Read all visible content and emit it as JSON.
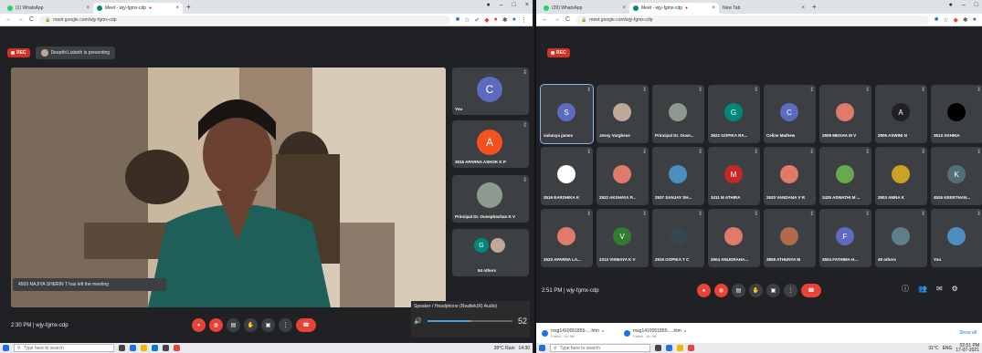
{
  "left": {
    "tabs": [
      {
        "label": "(1) WhatsApp"
      },
      {
        "label": "Meet - wjy-fgmx-cdp"
      }
    ],
    "url": "meet.google.com/wjy-fgmx-cdp",
    "rec": "REC",
    "presenting": "Deepthi Lisbeth is presenting",
    "side_tiles": [
      {
        "name": "You",
        "initial": "C",
        "color": "#5c6bc0"
      },
      {
        "name": "3515 APARNA ASHOK K P",
        "initial": "A",
        "color": "#f4511e"
      },
      {
        "name": "Principal Dr. Ousephachan K V",
        "initial": "",
        "color": "#8d9a8f"
      },
      {
        "name": "54 others",
        "initial": "G",
        "color": "#00897b"
      }
    ],
    "toast": "4509 NAJIYA SHERIN T has left the meeting",
    "time": "2:30 PM | wjy-fgmx-cdp",
    "volume": {
      "device": "Speaker / Headphone (Realtek(R) Audio)",
      "level": "52"
    },
    "taskbar": {
      "search": "Type here to search",
      "weather": "28°C Rain",
      "clock": "14:30"
    }
  },
  "right": {
    "tabs": [
      {
        "label": "(20) WhatsApp"
      },
      {
        "label": "Meet - wjy-fgmx-cdp"
      },
      {
        "label": "New Tab"
      }
    ],
    "url": "meet.google.com/wjy-fgmx-cdp",
    "rec": "REC",
    "tiles": [
      {
        "name": "sukanya james",
        "initial": "S",
        "color": "#5c6bc0"
      },
      {
        "name": "Jessy Varghese",
        "initial": "",
        "color": "#bfa89a"
      },
      {
        "name": "Principal Dr. Ouse...",
        "initial": "",
        "color": "#8d9a8f"
      },
      {
        "name": "3522 GOPIKA RA...",
        "initial": "G",
        "color": "#00897b"
      },
      {
        "name": "Celine Mathew",
        "initial": "C",
        "color": "#5c6bc0"
      },
      {
        "name": "2509 MEGHA M V",
        "initial": "",
        "color": "#e07a6b"
      },
      {
        "name": "2906 ASWINI N",
        "initial": "A",
        "color": "#202124"
      },
      {
        "name": "3513 AKHINA",
        "initial": "",
        "color": "#000000"
      },
      {
        "name": "3519 EARSHIKA K",
        "initial": "",
        "color": "#ffffff"
      },
      {
        "name": "2522 AKSHAYA P...",
        "initial": "",
        "color": "#e07a6b"
      },
      {
        "name": "2937 SANJAY SH...",
        "initial": "",
        "color": "#4a8fbf"
      },
      {
        "name": "3411 M ATHIRA",
        "initial": "M",
        "color": "#c62828"
      },
      {
        "name": "2520 VANDANA V R",
        "initial": "",
        "color": "#e07a6b"
      },
      {
        "name": "3425 ASWATHI M ...",
        "initial": "",
        "color": "#6aa84f"
      },
      {
        "name": "2903 AMNA K",
        "initial": "",
        "color": "#c9a227"
      },
      {
        "name": "4526 KEERTHAN...",
        "initial": "K",
        "color": "#546e7a"
      },
      {
        "name": "2523 APARNA LA...",
        "initial": "",
        "color": "#e07a6b"
      },
      {
        "name": "2314 VISMAYA K V",
        "initial": "V",
        "color": "#2e7d32"
      },
      {
        "name": "2915 GOPIKA T C",
        "initial": "",
        "color": "#37474f"
      },
      {
        "name": "2504 ANUGRAHA...",
        "initial": "",
        "color": "#e07a6b"
      },
      {
        "name": "3808 ATHUNYA M",
        "initial": "",
        "color": "#b36a4a"
      },
      {
        "name": "3504 FATHIMA H...",
        "initial": "F",
        "color": "#5c6bc0"
      },
      {
        "name": "49 others",
        "initial": "",
        "color": "#607d8b"
      },
      {
        "name": "You",
        "initial": "",
        "color": "#4a8fbf"
      }
    ],
    "time": "2:51 PM | wjy-fgmx-cdp",
    "downloads": [
      {
        "name": "msg1410051855-....htm",
        "status": "Failed - No file"
      },
      {
        "name": "msg1410051855-....htm",
        "status": "Failed - No file"
      }
    ],
    "show_all": "Show all",
    "taskbar": {
      "search": "Type here to search",
      "weather": "31°C",
      "lang": "ENG",
      "clock": "02:51 PM",
      "date": "17-07-2021"
    }
  }
}
